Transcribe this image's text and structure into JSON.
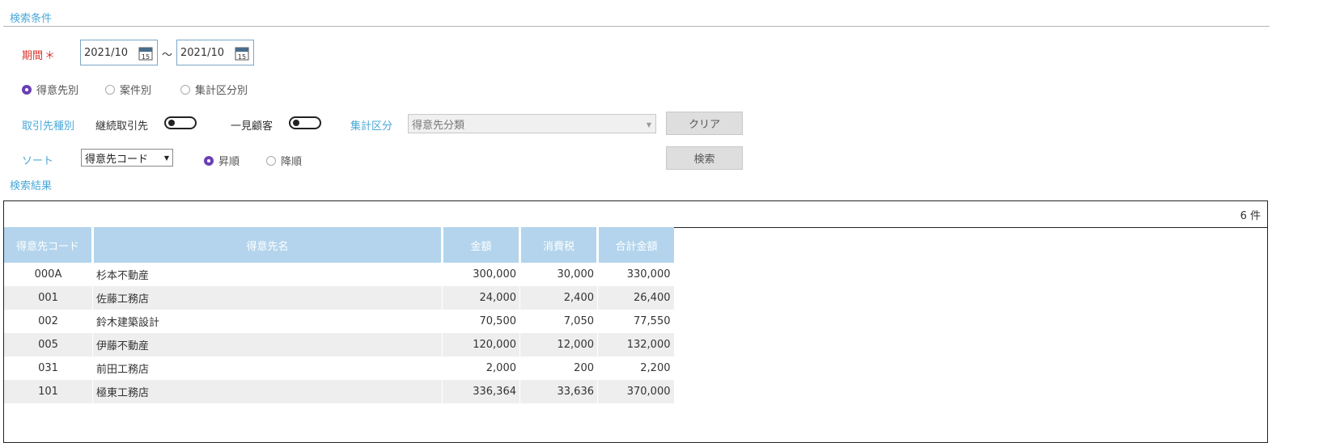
{
  "search": {
    "section_title": "検索条件",
    "period_label": "期間",
    "required_mark": "＊",
    "date_from": "2021/10",
    "date_to": "2021/10",
    "tilde": "～",
    "calendar_day": "15"
  },
  "group_by": {
    "options": [
      "得意先別",
      "案件別",
      "集計区分別"
    ],
    "selected": "得意先別"
  },
  "filters": {
    "partner_type_label": "取引先種別",
    "continuous_label": "継続取引先",
    "continuous_on": false,
    "onetime_label": "一見顧客",
    "onetime_on": false,
    "category_label": "集計区分",
    "category_value": "得意先分類"
  },
  "sort": {
    "label": "ソート",
    "field_value": "得意先コード",
    "order_options": [
      "昇順",
      "降順"
    ],
    "order_selected": "昇順"
  },
  "buttons": {
    "clear": "クリア",
    "search": "検索"
  },
  "results": {
    "section_title": "検索結果",
    "count_text": "6 件",
    "columns": [
      "得意先コード",
      "得意先名",
      "金額",
      "消費税",
      "合計金額"
    ],
    "rows": [
      [
        "000A",
        "杉本不動産",
        "300,000",
        "30,000",
        "330,000"
      ],
      [
        "001",
        "佐藤工務店",
        "24,000",
        "2,400",
        "26,400"
      ],
      [
        "002",
        "鈴木建築設計",
        "70,500",
        "7,050",
        "77,550"
      ],
      [
        "005",
        "伊藤不動産",
        "120,000",
        "12,000",
        "132,000"
      ],
      [
        "031",
        "前田工務店",
        "2,000",
        "200",
        "2,200"
      ],
      [
        "101",
        "極東工務店",
        "336,364",
        "33,636",
        "370,000"
      ]
    ]
  },
  "colors": {
    "accent_blue": "#4aa8d8",
    "required_red": "#d9342b",
    "radio_purple": "#6a3fb5",
    "header_blue": "#b3d4ec"
  }
}
